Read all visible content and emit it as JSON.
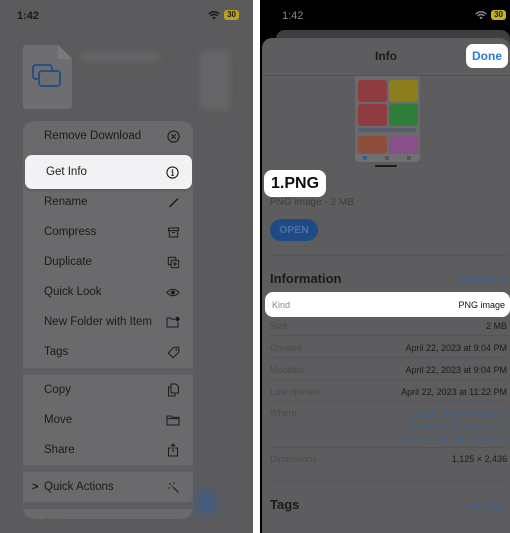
{
  "left_screen": {
    "status_bar": {
      "time": "1:42",
      "battery": "30"
    },
    "file_icon": "image-stack-icon",
    "context_menu": {
      "groups": [
        [
          {
            "label": "Remove Download",
            "icon": "x-circle-icon",
            "highlighted": false
          },
          {
            "label": "Get Info",
            "icon": "info-circle-icon",
            "highlighted": true
          },
          {
            "label": "Rename",
            "icon": "pencil-icon",
            "highlighted": false
          },
          {
            "label": "Compress",
            "icon": "archive-box-icon",
            "highlighted": false
          },
          {
            "label": "Duplicate",
            "icon": "duplicate-icon",
            "highlighted": false
          },
          {
            "label": "Quick Look",
            "icon": "eye-icon",
            "highlighted": false
          },
          {
            "label": "New Folder with Item",
            "icon": "folder-badge-icon",
            "highlighted": false
          },
          {
            "label": "Tags",
            "icon": "tag-icon",
            "highlighted": false
          }
        ],
        [
          {
            "label": "Copy",
            "icon": "copy-doc-icon"
          },
          {
            "label": "Move",
            "icon": "folder-icon"
          },
          {
            "label": "Share",
            "icon": "share-icon"
          }
        ],
        [
          {
            "label": "Quick Actions",
            "icon": "magic-wand-icon",
            "chevron": ">"
          }
        ],
        [
          {
            "label": "Delete",
            "icon": "trash-icon",
            "destructive": true
          }
        ]
      ]
    }
  },
  "right_screen": {
    "status_bar": {
      "time": "1:42",
      "battery": "30"
    },
    "sheet": {
      "title": "Info",
      "done_label": "Done",
      "file_name": "1.PNG",
      "file_meta": "PNG image - 2 MB",
      "open_label": "OPEN",
      "information": {
        "title": "Information",
        "show_more": "Show More",
        "rows": [
          {
            "key": "Kind",
            "value": "PNG image"
          },
          {
            "key": "Size",
            "value": "2 MB"
          },
          {
            "key": "Created",
            "value": "April 22, 2023 at 9:04 PM"
          },
          {
            "key": "Modified",
            "value": "April 22, 2023 at 9:04 PM"
          },
          {
            "key": "Last opened",
            "value": "April 22, 2023 at 11:22 PM"
          },
          {
            "key": "Where",
            "value_lines": [
              "iCloud Drive > How to fix",
              "Shortcuts not working on",
              "iphone > Add Wait to return"
            ]
          },
          {
            "key": "Dimensions",
            "value": "1,125 × 2,436"
          }
        ]
      },
      "tags": {
        "title": "Tags",
        "add_label": "Add Tags"
      }
    },
    "accent_color": "#2b7ad8"
  }
}
